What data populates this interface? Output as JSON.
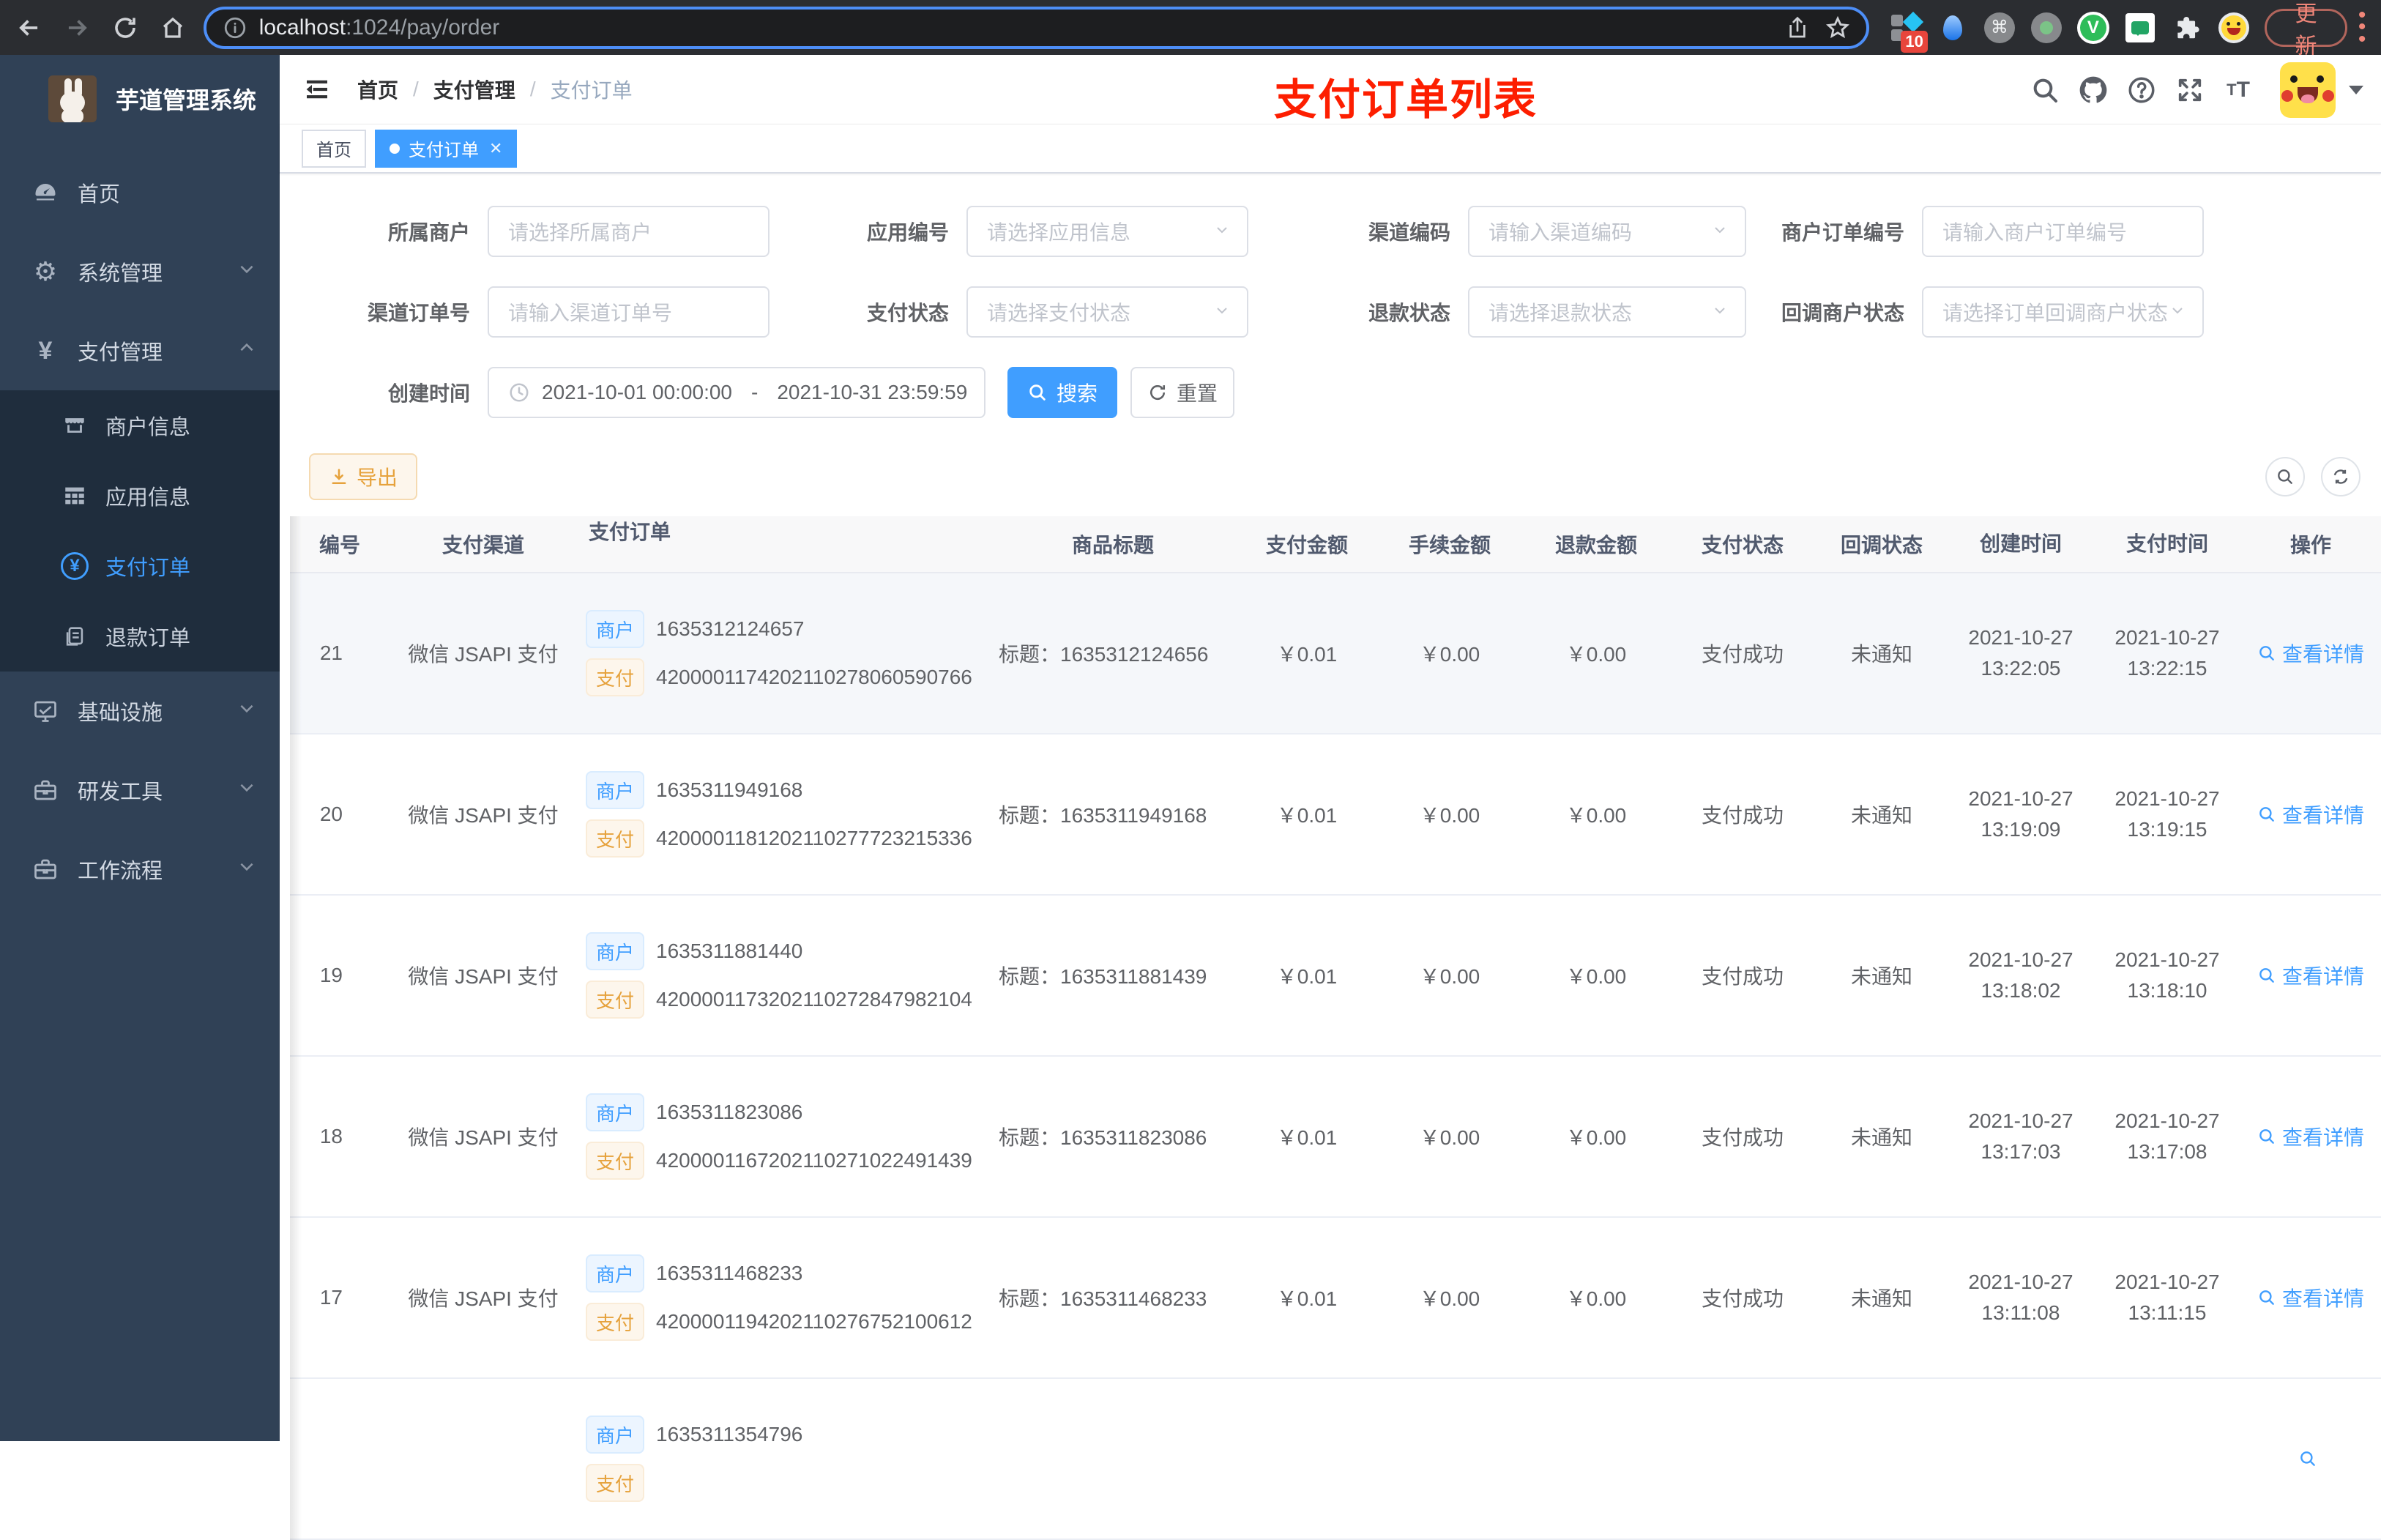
{
  "browser": {
    "url_host": "localhost",
    "url_path": ":1024/pay/order",
    "update_label": "更新",
    "extension_badge": "10"
  },
  "sidebar": {
    "title": "芋道管理系统",
    "menu": [
      {
        "label": "首页"
      },
      {
        "label": "系统管理"
      },
      {
        "label": "支付管理"
      }
    ],
    "submenu": [
      {
        "label": "商户信息"
      },
      {
        "label": "应用信息"
      },
      {
        "label": "支付订单"
      },
      {
        "label": "退款订单"
      }
    ],
    "menu2": [
      {
        "label": "基础设施"
      },
      {
        "label": "研发工具"
      },
      {
        "label": "工作流程"
      }
    ]
  },
  "header": {
    "breadcrumb": [
      "首页",
      "支付管理",
      "支付订单"
    ],
    "annotation": "支付订单列表"
  },
  "tabs": [
    {
      "label": "首页"
    },
    {
      "label": "支付订单"
    }
  ],
  "filter": {
    "fields": [
      {
        "label": "所属商户",
        "placeholder": "请选择所属商户"
      },
      {
        "label": "应用编号",
        "placeholder": "请选择应用信息"
      },
      {
        "label": "渠道编码",
        "placeholder": "请输入渠道编码"
      },
      {
        "label": "商户订单编号",
        "placeholder": "请输入商户订单编号"
      },
      {
        "label": "渠道订单号",
        "placeholder": "请输入渠道订单号"
      },
      {
        "label": "支付状态",
        "placeholder": "请选择支付状态"
      },
      {
        "label": "退款状态",
        "placeholder": "请选择退款状态"
      },
      {
        "label": "回调商户状态",
        "placeholder": "请选择订单回调商户状态"
      }
    ],
    "date": {
      "label": "创建时间",
      "start": "2021-10-01 00:00:00",
      "separator": "-",
      "end": "2021-10-31 23:59:59"
    },
    "search_label": "搜索",
    "reset_label": "重置"
  },
  "toolbar": {
    "export_label": "导出"
  },
  "table": {
    "headers": [
      "编号",
      "支付渠道",
      "支付订单",
      "商品标题",
      "支付金额",
      "手续金额",
      "退款金额",
      "支付状态",
      "回调状态",
      "创建时间",
      "支付时间",
      "操作"
    ],
    "merchant_tag": "商户",
    "pay_tag": "支付",
    "rows": [
      {
        "id": "21",
        "channel": "微信 JSAPI 支付",
        "merchant_no": "1635312124657",
        "pay_no": "4200001174202110278060590766",
        "title": "标题：1635312124656",
        "amount": "￥0.01",
        "fee": "￥0.00",
        "refund": "￥0.00",
        "status": "支付成功",
        "notify": "未通知",
        "create_date": "2021-10-27",
        "create_time": "13:22:05",
        "pay_date": "2021-10-27",
        "pay_time": "13:22:15",
        "action": "查看详情"
      },
      {
        "id": "20",
        "channel": "微信 JSAPI 支付",
        "merchant_no": "1635311949168",
        "pay_no": "4200001181202110277723215336",
        "title": "标题：1635311949168",
        "amount": "￥0.01",
        "fee": "￥0.00",
        "refund": "￥0.00",
        "status": "支付成功",
        "notify": "未通知",
        "create_date": "2021-10-27",
        "create_time": "13:19:09",
        "pay_date": "2021-10-27",
        "pay_time": "13:19:15",
        "action": "查看详情"
      },
      {
        "id": "19",
        "channel": "微信 JSAPI 支付",
        "merchant_no": "1635311881440",
        "pay_no": "4200001173202110272847982104",
        "title": "标题：1635311881439",
        "amount": "￥0.01",
        "fee": "￥0.00",
        "refund": "￥0.00",
        "status": "支付成功",
        "notify": "未通知",
        "create_date": "2021-10-27",
        "create_time": "13:18:02",
        "pay_date": "2021-10-27",
        "pay_time": "13:18:10",
        "action": "查看详情"
      },
      {
        "id": "18",
        "channel": "微信 JSAPI 支付",
        "merchant_no": "1635311823086",
        "pay_no": "4200001167202110271022491439",
        "title": "标题：1635311823086",
        "amount": "￥0.01",
        "fee": "￥0.00",
        "refund": "￥0.00",
        "status": "支付成功",
        "notify": "未通知",
        "create_date": "2021-10-27",
        "create_time": "13:17:03",
        "pay_date": "2021-10-27",
        "pay_time": "13:17:08",
        "action": "查看详情"
      },
      {
        "id": "17",
        "channel": "微信 JSAPI 支付",
        "merchant_no": "1635311468233",
        "pay_no": "4200001194202110276752100612",
        "title": "标题：1635311468233",
        "amount": "￥0.01",
        "fee": "￥0.00",
        "refund": "￥0.00",
        "status": "支付成功",
        "notify": "未通知",
        "create_date": "2021-10-27",
        "create_time": "13:11:08",
        "pay_date": "2021-10-27",
        "pay_time": "13:11:15",
        "action": "查看详情"
      },
      {
        "id": "",
        "channel": "",
        "merchant_no": "1635311354796",
        "pay_no": "",
        "title": "",
        "amount": "",
        "fee": "",
        "refund": "",
        "status": "",
        "notify": "",
        "create_date": "",
        "create_time": "",
        "pay_date": "",
        "pay_time": "",
        "action": ""
      }
    ]
  },
  "colors": {
    "accent": "#409EFF",
    "warning": "#E6A23C",
    "annotation_red": "#FD1E00",
    "sidebar_bg": "#304156",
    "submenu_bg": "#1F2D3D"
  }
}
